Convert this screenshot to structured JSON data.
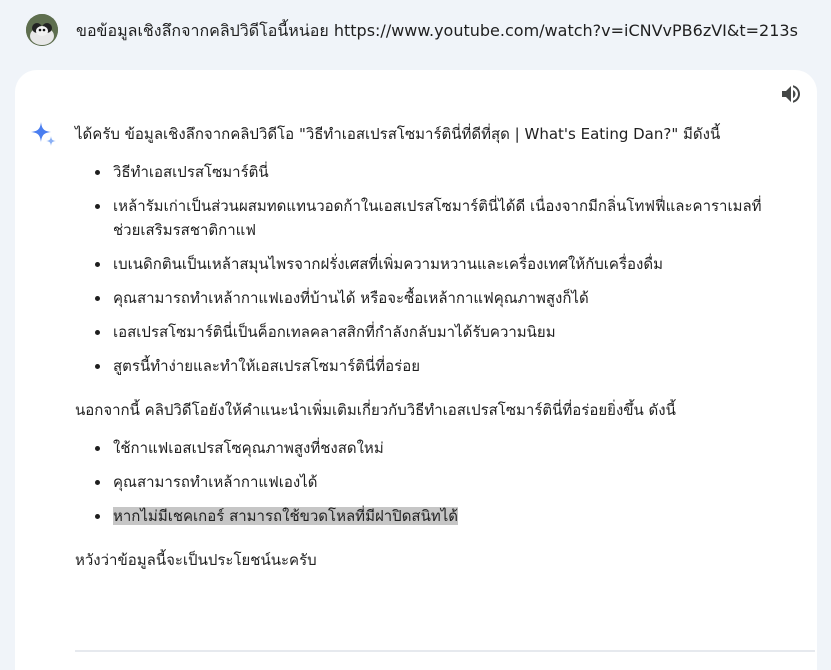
{
  "user_query": {
    "text": "ขอข้อมูลเชิงลึกจากคลิปวิดีโอนี้หน่อย https://www.youtube.com/watch?v=iCNVvPB6zVI&t=213s"
  },
  "response": {
    "intro": "ได้ครับ ข้อมูลเชิงลึกจากคลิปวิดีโอ \"วิธีทำเอสเปรสโซมาร์ตินี่ที่ดีที่สุด | What's Eating Dan?\" มีดังนี้",
    "list1": [
      "วิธีทำเอสเปรสโซมาร์ตินี่",
      "เหล้ารัมเก่าเป็นส่วนผสมทดแทนวอดก้าในเอสเปรสโซมาร์ตินี่ได้ดี เนื่องจากมีกลิ่นโทฟฟี่และคาราเมลที่ช่วยเสริมรสชาติกาแฟ",
      "เบเนดิกตินเป็นเหล้าสมุนไพรจากฝรั่งเศสที่เพิ่มความหวานและเครื่องเทศให้กับเครื่องดื่ม",
      "คุณสามารถทำเหล้ากาแฟเองที่บ้านได้ หรือจะซื้อเหล้ากาแฟคุณภาพสูงก็ได้",
      "เอสเปรสโซมาร์ตินี่เป็นค็อกเทลคลาสสิกที่กำลังกลับมาได้รับความนิยม",
      "สูตรนี้ทำง่ายและทำให้เอสเปรสโซมาร์ตินี่ที่อร่อย"
    ],
    "middle": "นอกจากนี้ คลิปวิดีโอยังให้คำแนะนำเพิ่มเติมเกี่ยวกับวิธีทำเอสเปรสโซมาร์ตินี่ที่อร่อยยิ่งขึ้น ดังนี้",
    "list2": [
      "ใช้กาแฟเอสเปรสโซคุณภาพสูงที่ชงสดใหม่",
      "คุณสามารถทำเหล้ากาแฟเองได้",
      "หากไม่มีเชคเกอร์ สามารถใช้ขวดโหลที่มีฝาปิดสนิทได้"
    ],
    "closing": "หวังว่าข้อมูลนี้จะเป็นประโยชน์นะครับ"
  },
  "icons": {
    "speaker": "speaker-icon",
    "gemini": "gemini-spark-icon",
    "avatar": "user-avatar"
  },
  "colors": {
    "background": "#f0f4f9",
    "card": "#ffffff",
    "highlight": "#c6c6c6",
    "spark_blue": "#4a7ef0"
  }
}
